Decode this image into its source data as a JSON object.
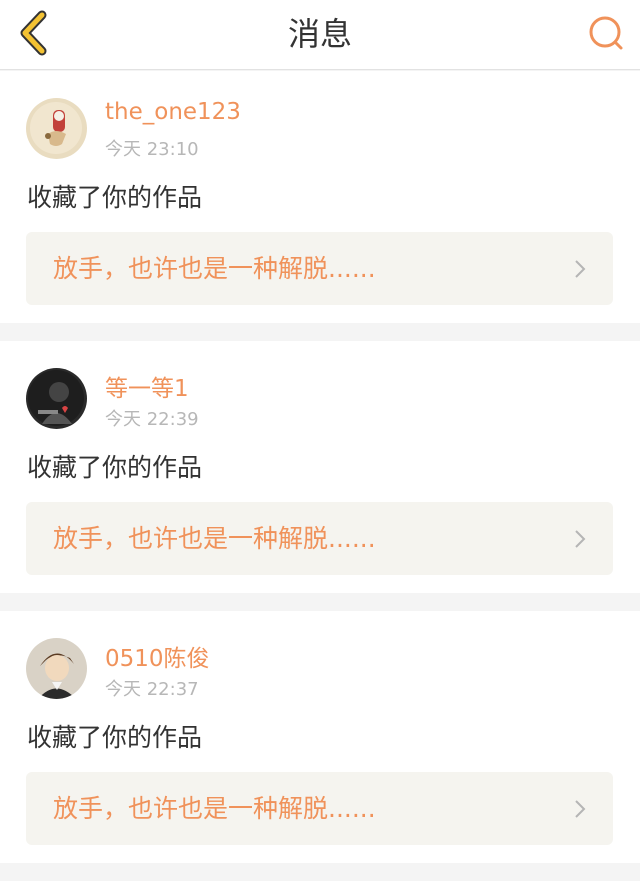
{
  "header": {
    "title": "消息",
    "back_icon": "chevron-left-icon",
    "search_icon": "search-icon",
    "accent_color": "#f0925a"
  },
  "messages": [
    {
      "username": "the_one123",
      "time": "今天 23:10",
      "action": "收藏了你的作品",
      "work_title": "放手，也许也是一种解脱......"
    },
    {
      "username": "等一等1",
      "time": "今天 22:39",
      "action": "收藏了你的作品",
      "work_title": "放手，也许也是一种解脱......"
    },
    {
      "username": "0510陈俊",
      "time": "今天 22:37",
      "action": "收藏了你的作品",
      "work_title": "放手，也许也是一种解脱......"
    }
  ]
}
